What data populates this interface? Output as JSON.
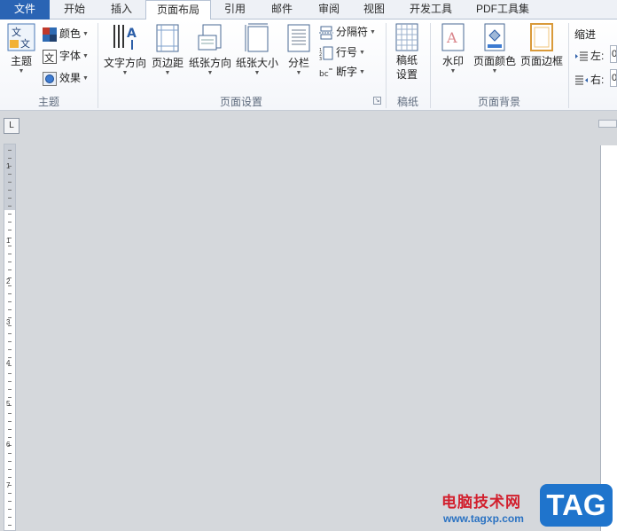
{
  "tabs": {
    "file": "文件",
    "home": "开始",
    "insert": "插入",
    "page_layout": "页面布局",
    "references": "引用",
    "mailings": "邮件",
    "review": "审阅",
    "view": "视图",
    "developer": "开发工具",
    "pdf": "PDF工具集"
  },
  "ribbon": {
    "theme_group": {
      "label": "主题",
      "themes": "主题",
      "colors": "颜色",
      "fonts": "字体",
      "effects": "效果"
    },
    "page_setup_group": {
      "label": "页面设置",
      "text_direction": "文字方向",
      "margins": "页边距",
      "orientation": "纸张方向",
      "size": "纸张大小",
      "columns": "分栏",
      "breaks": "分隔符",
      "line_numbers": "行号",
      "hyphenation": "断字"
    },
    "manuscript_group": {
      "label": "稿纸",
      "setup_line1": "稿纸",
      "setup_line2": "设置"
    },
    "background_group": {
      "label": "页面背景",
      "watermark": "水印",
      "page_color": "页面颜色",
      "page_borders": "页面边框"
    },
    "paragraph_group": {
      "indent": "缩进",
      "left": "左:",
      "right": "右:",
      "left_value": "0",
      "right_value": "0"
    }
  },
  "ruler": {
    "corner": "L",
    "numbers": [
      "1",
      "1",
      "2",
      "3",
      "4",
      "5",
      "6",
      "7"
    ]
  },
  "watermark": {
    "site_name": "电脑技术网",
    "url": "www.tagxp.com",
    "badge": "TAG"
  },
  "colors": {
    "file_tab": "#2a64b4",
    "workspace": "#d5d8dc",
    "watermark_red": "#d21f2d",
    "watermark_blue": "#1f74cc"
  }
}
